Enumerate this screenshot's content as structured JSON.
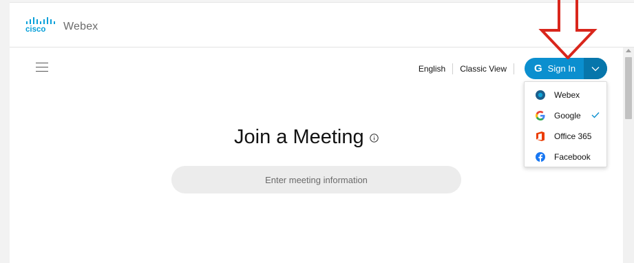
{
  "brand": {
    "vendor": "cisco",
    "product": "Webex",
    "logo_color": "#049fd9"
  },
  "header": {
    "nav": [
      {
        "label": "English"
      },
      {
        "label": "Classic View"
      }
    ],
    "signin": {
      "label": "Sign In",
      "icon": "google-g-icon",
      "color": "#0b8fcf"
    }
  },
  "signin_menu": {
    "items": [
      {
        "label": "Webex",
        "icon": "webex-icon",
        "selected": false
      },
      {
        "label": "Google",
        "icon": "google-icon",
        "selected": true
      },
      {
        "label": "Office 365",
        "icon": "office365-icon",
        "selected": false
      },
      {
        "label": "Facebook",
        "icon": "facebook-icon",
        "selected": false
      }
    ]
  },
  "main": {
    "title": "Join a Meeting",
    "meeting_input": {
      "placeholder": "Enter meeting information",
      "value": ""
    }
  },
  "annotation": {
    "arrow_color": "#d9261c"
  }
}
